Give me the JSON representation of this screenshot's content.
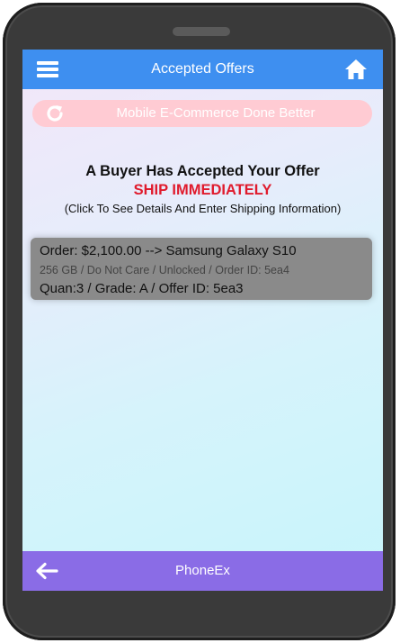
{
  "header": {
    "title": "Accepted Offers",
    "menu_icon": "hamburger-menu-icon",
    "home_icon": "home-icon",
    "color": "#3e8ff0"
  },
  "banner": {
    "text": "Mobile E-Commerce Done Better",
    "icon": "refresh-icon",
    "color": "#ffcbd3"
  },
  "notice": {
    "headline": "A Buyer Has Accepted Your Offer",
    "alert": "SHIP IMMEDIATELY",
    "instructions": "(Click To See Details And Enter Shipping Information)",
    "alert_color": "#e01b2d"
  },
  "offers": [
    {
      "line1": "Order: $2,100.00 --> Samsung Galaxy S10",
      "line2": "256 GB / Do Not Care / Unlocked / Order ID: 5ea4",
      "line3": "Quan:3 / Grade: A / Offer ID: 5ea3"
    }
  ],
  "footer": {
    "title": "PhoneEx",
    "back_icon": "back-arrow-icon",
    "color": "#8a6ce6"
  }
}
